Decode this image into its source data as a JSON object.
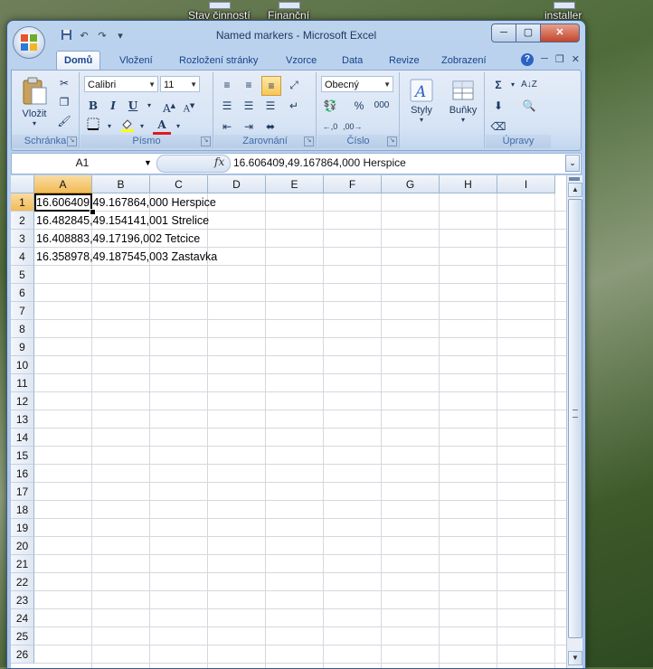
{
  "desktop": {
    "icons": [
      {
        "label": "Stav činností"
      },
      {
        "label": "Finanční"
      },
      {
        "label": "installer"
      }
    ]
  },
  "window": {
    "title": "Named markers - Microsoft Excel"
  },
  "ribbon": {
    "tabs": [
      "Domů",
      "Vložení",
      "Rozložení stránky",
      "Vzorce",
      "Data",
      "Revize",
      "Zobrazení"
    ],
    "active_tab": "Domů",
    "clipboard": {
      "paste_label": "Vložit",
      "group_label": "Schránka"
    },
    "font": {
      "name": "Calibri",
      "size": "11",
      "bold": "B",
      "italic": "I",
      "underline": "U",
      "group_label": "Písmo"
    },
    "alignment": {
      "group_label": "Zarovnání"
    },
    "number": {
      "format": "Obecný",
      "percent": "%",
      "thousands": "000",
      "group_label": "Číslo"
    },
    "styles": {
      "label": "Styly"
    },
    "cells": {
      "label": "Buňky"
    },
    "editing": {
      "group_label": "Úpravy"
    }
  },
  "formula_bar": {
    "name_box": "A1",
    "fx": "fx",
    "content": "16.606409,49.167864,000 Herspice"
  },
  "sheet": {
    "columns": [
      "A",
      "B",
      "C",
      "D",
      "E",
      "F",
      "G",
      "H",
      "I"
    ],
    "rows": [
      "1",
      "2",
      "3",
      "4",
      "5",
      "6",
      "7",
      "8",
      "9",
      "10",
      "11",
      "12",
      "13",
      "14",
      "15",
      "16",
      "17",
      "18",
      "19",
      "20",
      "21",
      "22",
      "23",
      "24",
      "25",
      "26"
    ],
    "cells": [
      "16.606409,49.167864,000 Herspice",
      "16.482845,49.154141,001 Strelice",
      "16.408883,49.17196,002 Tetcice",
      "16.358978,49.187545,003 Zastavka"
    ],
    "selected_cell": "A1"
  }
}
